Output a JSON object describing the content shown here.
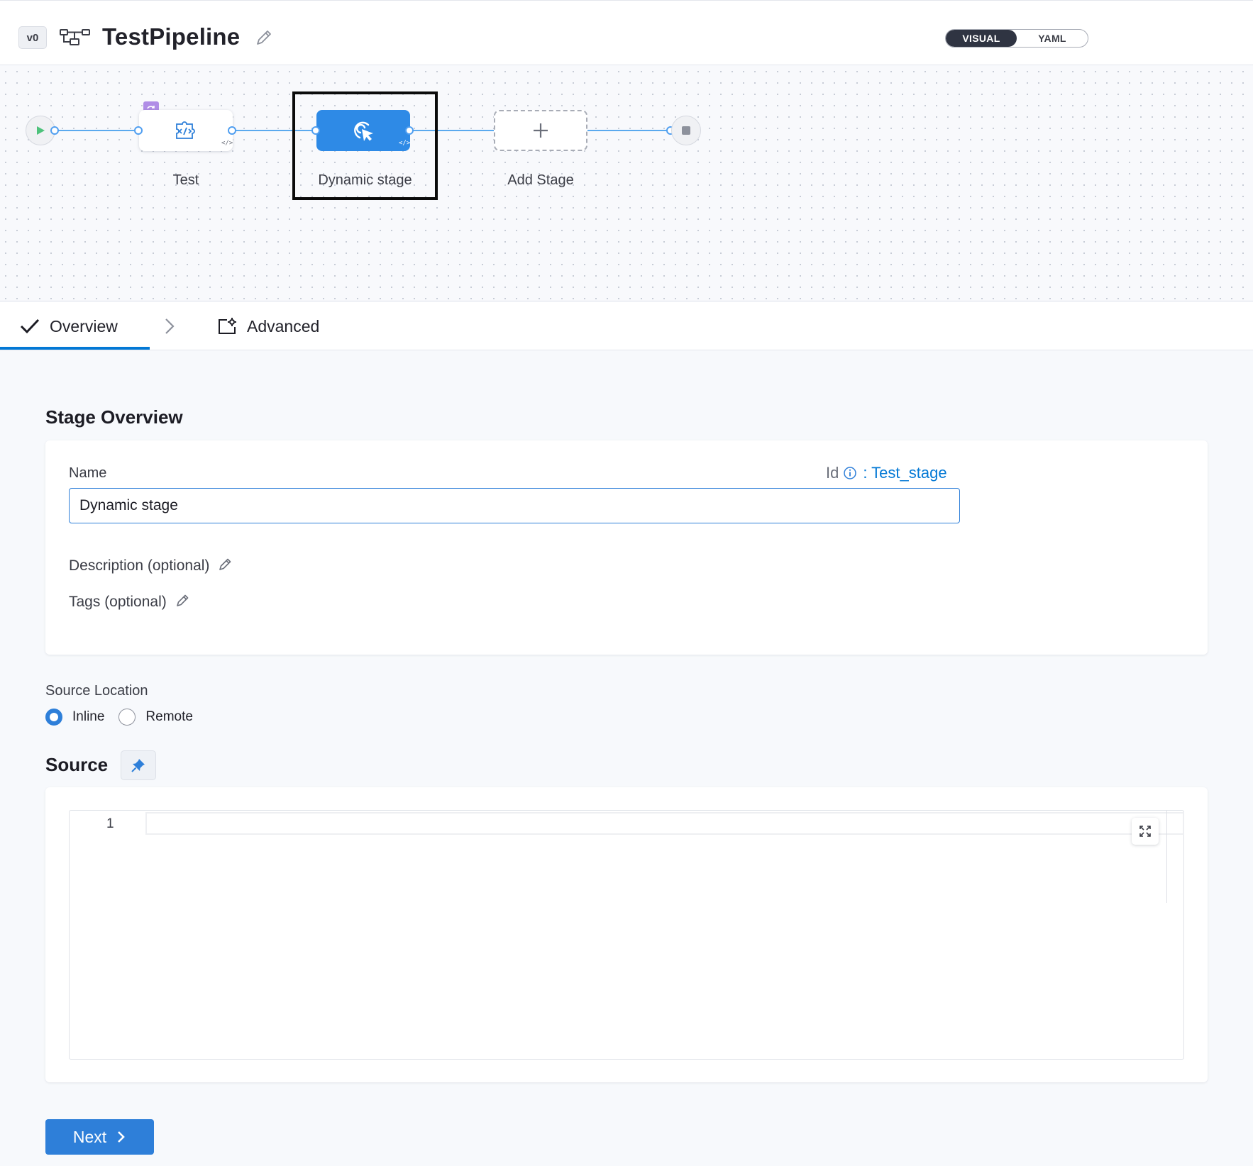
{
  "header": {
    "version_badge": "v0",
    "pipeline_name": "TestPipeline",
    "view_toggle": {
      "visual_label": "VISUAL",
      "yaml_label": "YAML",
      "active": "VISUAL"
    }
  },
  "canvas": {
    "stages": [
      {
        "name": "Test",
        "icon": "custom-stage-code-icon",
        "looping": true
      },
      {
        "name": "Dynamic stage",
        "icon": "dynamic-stage-cursor-icon",
        "selected": true
      },
      {
        "name": "Add Stage",
        "icon": "plus-icon"
      }
    ],
    "start_icon": "play-icon",
    "end_icon": "stop-icon"
  },
  "tabs": [
    {
      "label": "Overview",
      "icon": "check-icon",
      "active": true
    },
    {
      "label": "Advanced",
      "icon": "settings-box-icon",
      "active": false
    }
  ],
  "overview": {
    "heading": "Stage Overview",
    "name_label": "Name",
    "id_label": "Id",
    "id_value": ": Test_stage",
    "name_value": "Dynamic stage",
    "description_label": "Description (optional)",
    "tags_label": "Tags (optional)"
  },
  "source_location": {
    "label": "Source Location",
    "options": [
      {
        "label": "Inline",
        "selected": true
      },
      {
        "label": "Remote",
        "selected": false
      }
    ]
  },
  "source": {
    "heading": "Source",
    "line_numbers": [
      "1"
    ]
  },
  "footer": {
    "next_label": "Next"
  },
  "colors": {
    "accent": "#2e7fd9",
    "stage_selected": "#2e8ae6",
    "link": "#0278d5",
    "loop_badge": "#b08de6"
  }
}
